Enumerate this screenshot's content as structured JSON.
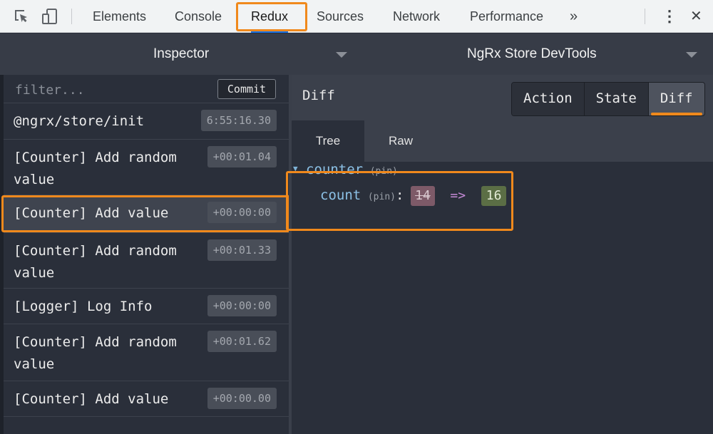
{
  "devtools": {
    "tabs": [
      "Elements",
      "Console",
      "Redux",
      "Sources",
      "Network",
      "Performance"
    ],
    "active_tab": "Redux",
    "overflow": "»",
    "menu": "⋮",
    "close": "✕"
  },
  "monitor": {
    "left_title": "Inspector",
    "right_title": "NgRx Store DevTools"
  },
  "actions_list": {
    "filter_placeholder": "filter...",
    "commit_label": "Commit",
    "items": [
      {
        "line1": "@ngrx/store/init",
        "line2": "",
        "time": "6:55:16.30"
      },
      {
        "line1": "[Counter] Add random",
        "line2": "value",
        "time": "+00:01.04"
      },
      {
        "line1": "[Counter] Add value",
        "line2": "",
        "time": "+00:00:00"
      },
      {
        "line1": "[Counter] Add random",
        "line2": "value",
        "time": "+00:01.33"
      },
      {
        "line1": "[Logger] Log Info",
        "line2": "",
        "time": "+00:00:00"
      },
      {
        "line1": "[Counter] Add random",
        "line2": "value",
        "time": "+00:01.62"
      },
      {
        "line1": "[Counter] Add value",
        "line2": "",
        "time": "+00:00.00"
      }
    ],
    "selected_index": 2
  },
  "diff_panel": {
    "title": "Diff",
    "segments": [
      "Action",
      "State",
      "Diff"
    ],
    "active_segment": "Diff",
    "subtabs": [
      "Tree",
      "Raw"
    ],
    "active_subtab": "Tree",
    "tree": {
      "arrow": "▼",
      "root_key": "counter",
      "root_pin": "(pin)",
      "child_key": "count",
      "child_pin": "(pin)",
      "colon": ":",
      "old_value": "14",
      "arrow_sym": "=>",
      "new_value": "16"
    }
  },
  "colors": {
    "highlight": "#f0891c",
    "background": "#2a2f3a",
    "old_value_bg": "#7d5a68",
    "new_value_bg": "#5b6e45"
  }
}
